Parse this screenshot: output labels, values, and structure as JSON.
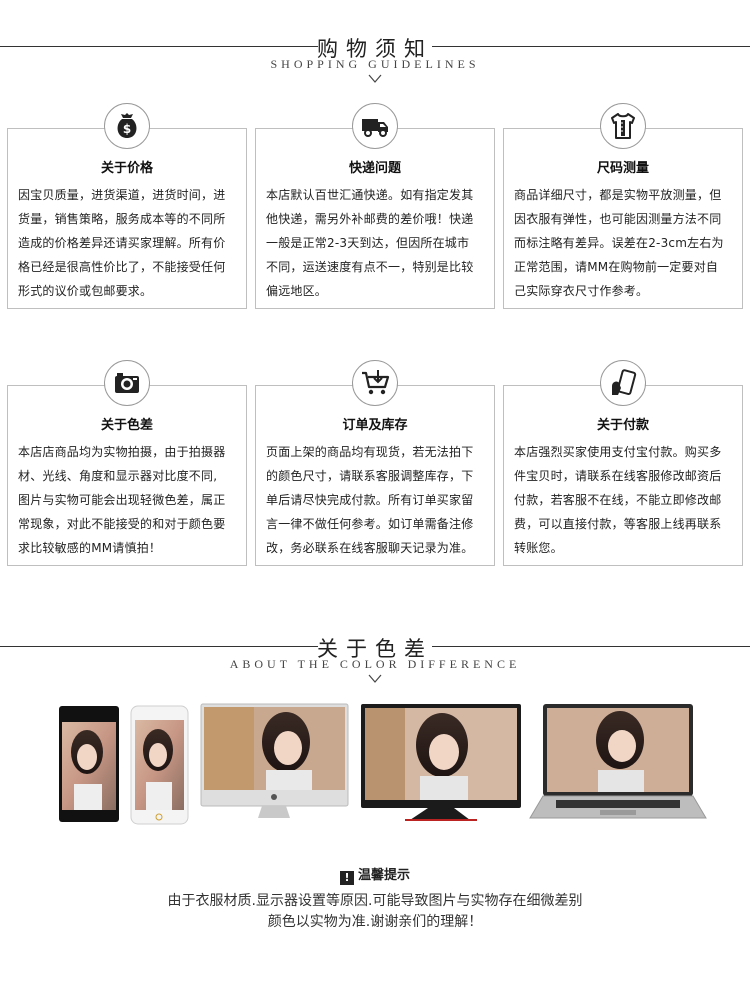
{
  "guidelines_header": {
    "title": "购物须知",
    "subtitle": "SHOPPING GUIDELINES"
  },
  "cards": [
    {
      "title": "关于价格",
      "icon": "money-bag-icon",
      "lines": [
        "因宝贝质量，进货渠道，进货时间，进",
        "货量，销售策略，服务成本等的不同所",
        "造成的价格差异还请买家理解。所有价",
        "格已经是很高性价比了，不能接受任何",
        "形式的议价或包邮要求。"
      ]
    },
    {
      "title": "快递问题",
      "icon": "truck-icon",
      "lines": [
        "本店默认百世汇通快递。如有指定发其",
        "他快递，需另外补邮费的差价哦！快递",
        "一般是正常2-3天到达，但因所在城市",
        "不同，运送速度有点不一，特别是比较",
        "偏远地区。"
      ]
    },
    {
      "title": "尺码测量",
      "icon": "shirt-ruler-icon",
      "lines": [
        "商品详细尺寸，都是实物平放测量，但",
        "因衣服有弹性，也可能因测量方法不同",
        "而标注略有差异。误差在2-3cm左右为",
        "正常范围，请MM在购物前一定要对自",
        "己实际穿衣尺寸作参考。"
      ]
    },
    {
      "title": "关于色差",
      "icon": "camera-icon",
      "lines": [
        "本店店商品均为实物拍摄，由于拍摄器",
        "材、光线、角度和显示器对比度不同,",
        "图片与实物可能会出现轻微色差，属正",
        "常现象，对此不能接受的和对于颜色要",
        "求比较敏感的MM请慎拍！"
      ]
    },
    {
      "title": "订单及库存",
      "icon": "cart-icon",
      "lines": [
        "页面上架的商品均有现货，若无法拍下",
        "的颜色尺寸，请联系客服调整库存，下",
        "单后请尽快完成付款。所有订单买家留",
        "言一律不做任何参考。如订单需备注修",
        "改，务必联系在线客服聊天记录为准。"
      ]
    },
    {
      "title": "关于付款",
      "icon": "card-payment-icon",
      "lines": [
        "本店强烈买家使用支付宝付款。购买多",
        "件宝贝时，请联系在线客服修改邮资后",
        "付款，若客服不在线，不能立即修改邮",
        "费，可以直接付款，等客服上线再联系",
        "转账您。"
      ]
    }
  ],
  "color_header": {
    "title": "关于色差",
    "subtitle": "ABOUT THE COLOR DIFFERENCE"
  },
  "notice": {
    "heading": "温馨提示",
    "bang": "!",
    "line1": "由于衣服材质.显示器设置等原因.可能导致图片与实物存在细微差别",
    "line2": "颜色以实物为准.谢谢亲们的理解！"
  }
}
